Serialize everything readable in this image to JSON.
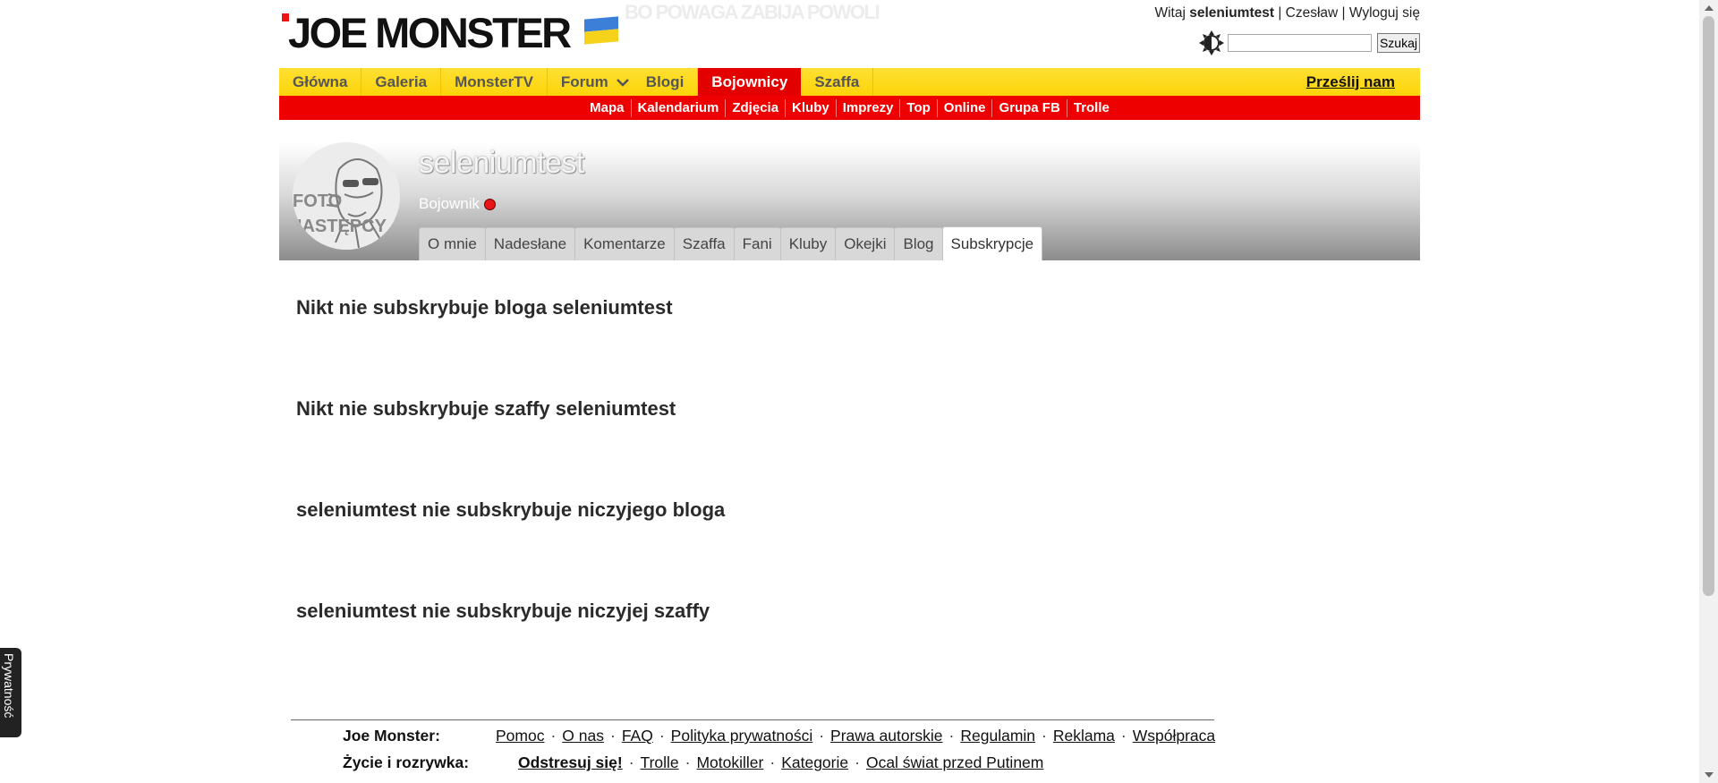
{
  "header": {
    "logo_text": "JOE MONSTER",
    "slogan": "BO POWAGA ZABIJA POWOLI",
    "greeting": "Witaj",
    "username": "seleniumtest",
    "user_link": "Czesław",
    "logout": "Wyloguj się",
    "search_placeholder": "",
    "search_button": "Szukaj",
    "theme_icon": "theme-toggle-icon"
  },
  "main_nav": {
    "items": [
      "Główna",
      "Galeria",
      "MonsterTV",
      "Forum",
      "Blogi",
      "Bojownicy",
      "Szaffa"
    ],
    "active": "Bojownicy",
    "send_link": "Prześlij nam"
  },
  "sub_nav": {
    "items": [
      "Mapa",
      "Kalendarium",
      "Zdjęcia",
      "Kluby",
      "Imprezy",
      "Top",
      "Online",
      "Grupa FB",
      "Trolle"
    ]
  },
  "profile": {
    "name": "seleniumtest",
    "rank": "Bojownik",
    "avatar_text": "FOTO NASTĘPCY",
    "tabs": [
      "O mnie",
      "Nadesłane",
      "Komentarze",
      "Szaffa",
      "Fani",
      "Kluby",
      "Okejki",
      "Blog",
      "Subskrypcje"
    ],
    "active_tab": "Subskrypcje"
  },
  "content": {
    "headings": [
      "Nikt nie subskrybuje bloga seleniumtest",
      "Nikt nie subskrybuje szaffy seleniumtest",
      "seleniumtest nie subskrybuje niczyjego bloga",
      "seleniumtest nie subskrybuje niczyjej szaffy"
    ]
  },
  "footer": {
    "row1_label": "Joe Monster:",
    "row1_links": [
      "Pomoc",
      "O nas",
      "FAQ",
      "Polityka prywatności",
      "Prawa autorskie",
      "Regulamin",
      "Reklama",
      "Współpraca"
    ],
    "row2_label": "Życie i rozrywka:",
    "row2_links": [
      "Odstresuj się!",
      "Trolle",
      "Motokiller",
      "Kategorie",
      "Ocal świat przed Putinem"
    ]
  },
  "privacy_tab": "Prywatność",
  "colors": {
    "nav_yellow": "#fcd408",
    "nav_red": "#ee0000",
    "active_red": "#e20000"
  }
}
